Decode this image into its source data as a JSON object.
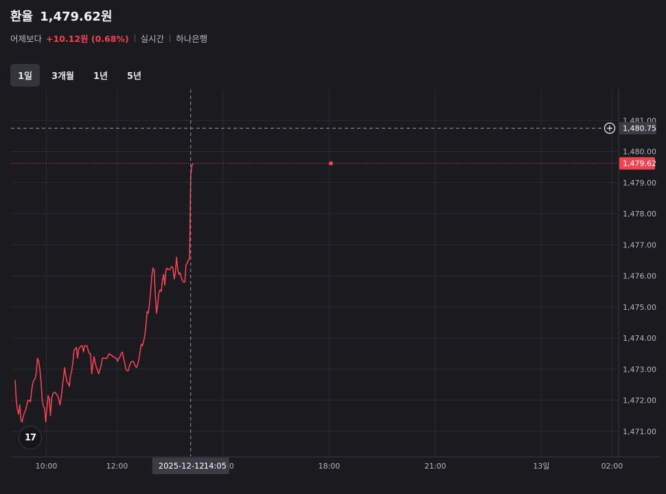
{
  "header": {
    "title": "환율",
    "price": "1,479.62원",
    "change_label": "어제보다",
    "change_value": "+10.12원 (0.68%)",
    "realtime": "실시간",
    "source": "하나은행"
  },
  "tabs": [
    {
      "label": "1일",
      "active": true
    },
    {
      "label": "3개월",
      "active": false
    },
    {
      "label": "1년",
      "active": false
    },
    {
      "label": "5년",
      "active": false
    }
  ],
  "logo_text": "17",
  "crosshair": {
    "date_label": "2025-12-12",
    "time_label": "14:05",
    "y_label": "1,480.75",
    "x_minutes": 845,
    "y_value": 1480.75
  },
  "colors": {
    "background": "#1b1a1f",
    "line": "#f04452",
    "grid": "#2a2a30",
    "axis_text": "#b5b5bc",
    "label_bg": "#3b3b43",
    "current_bg": "#f04452"
  },
  "chart_data": {
    "type": "line",
    "title": "",
    "xlabel": "",
    "ylabel": "",
    "ylim": [
      1470.2,
      1482.0
    ],
    "y_ticks": [
      1471.0,
      1472.0,
      1473.0,
      1474.0,
      1475.0,
      1476.0,
      1477.0,
      1478.0,
      1479.0,
      1480.0,
      1481.0
    ],
    "x_ticks": [
      {
        "label": "10:00",
        "minutes": 600
      },
      {
        "label": "12:00",
        "minutes": 720
      },
      {
        "label": "15:00",
        "minutes": 900
      },
      {
        "label": "18:00",
        "minutes": 1080
      },
      {
        "label": "21:00",
        "minutes": 1260
      },
      {
        "label": "13일",
        "minutes": 1440
      },
      {
        "label": "02:00",
        "minutes": 1560
      }
    ],
    "x_range_minutes": [
      540,
      1570
    ],
    "last_value_label": "1,479.62",
    "series": [
      {
        "x_minutes": [
          547,
          549,
          551,
          553,
          555,
          557,
          559,
          561,
          563,
          565,
          567,
          569,
          571,
          573,
          575,
          577,
          579,
          581,
          583,
          585,
          587,
          589,
          591,
          593,
          595,
          597,
          599,
          601,
          603,
          605,
          607,
          609,
          611,
          613,
          615,
          617,
          619,
          621,
          623,
          625,
          627,
          629,
          631,
          633,
          635,
          637,
          639,
          641,
          643,
          645,
          647,
          649,
          651,
          653,
          655,
          657,
          659,
          661,
          663,
          665,
          667,
          669,
          671,
          673,
          675,
          677,
          679,
          681,
          683,
          685,
          687,
          689,
          691,
          693,
          695,
          697,
          699,
          701,
          703,
          705,
          707,
          709,
          711,
          713,
          715,
          717,
          719,
          721,
          723,
          725,
          727,
          729,
          731,
          733,
          735,
          737,
          739,
          741,
          743,
          745,
          747,
          749,
          751,
          753,
          755,
          757,
          759,
          761,
          763,
          765,
          767,
          769,
          771,
          773,
          775,
          777,
          779,
          781,
          783,
          785,
          787,
          789,
          791,
          793,
          795,
          797,
          799,
          801,
          803,
          805,
          807,
          809,
          811,
          813,
          815,
          817,
          819,
          821,
          823,
          825,
          827,
          829,
          831,
          833,
          835,
          837,
          839,
          841,
          843,
          845,
          847,
          849,
          851,
          853,
          855,
          857,
          859,
          861,
          863,
          865,
          867,
          869,
          871,
          873,
          875,
          877,
          879,
          881,
          883,
          885,
          887,
          889,
          891,
          893,
          895,
          897,
          899,
          901,
          903,
          905,
          907,
          909,
          911,
          913,
          915,
          917,
          919,
          921,
          923,
          925,
          927,
          929,
          931,
          933,
          935,
          937,
          939,
          941,
          943,
          945,
          947,
          949,
          951,
          953,
          955,
          957,
          959,
          961,
          963,
          965,
          967,
          969,
          971,
          973,
          975,
          977,
          979,
          981,
          983,
          985,
          987,
          989,
          991,
          993,
          995,
          997,
          999,
          1001,
          1003,
          1005,
          1007,
          1009,
          1011,
          1013,
          1015,
          1017,
          1019,
          1021,
          1023,
          1025,
          1027,
          1029,
          1031,
          1033,
          1035,
          1037,
          1039,
          1041,
          1043,
          1045,
          1047,
          1049,
          1051,
          1053,
          1055,
          1057,
          1059,
          1061,
          1063,
          1065,
          1067,
          1069,
          1071,
          1073,
          1075,
          1077,
          1079,
          1081,
          1083
        ],
        "values": [
          1472.65,
          1472.0,
          1471.7,
          1471.55,
          1471.85,
          1471.35,
          1471.3,
          1471.5,
          1471.6,
          1471.7,
          1471.85,
          1472.0,
          1472.0,
          1471.95,
          1472.3,
          1472.55,
          1472.65,
          1472.7,
          1472.9,
          1473.35,
          1473.25,
          1473.0,
          1472.6,
          1472.0,
          1471.8,
          1471.75,
          1471.3,
          1471.75,
          1472.15,
          1472.05,
          1471.5,
          1472.05,
          1472.2,
          1472.25,
          1472.25,
          1472.2,
          1472.15,
          1472.05,
          1471.85,
          1472.05,
          1472.4,
          1472.7,
          1473.05,
          1472.8,
          1472.6,
          1472.55,
          1472.45,
          1472.8,
          1472.95,
          1473.2,
          1473.6,
          1473.65,
          1473.7,
          1473.35,
          1473.65,
          1473.7,
          1473.75,
          1473.75,
          1473.55,
          1473.75,
          1473.75,
          1473.75,
          1473.6,
          1473.5,
          1473.5,
          1472.85,
          1473.15,
          1473.4,
          1473.2,
          1473.05,
          1472.95,
          1472.85,
          1473.0,
          1473.1,
          1473.35,
          1473.35,
          1473.35,
          1473.35,
          1473.35,
          1473.45,
          1473.5,
          1473.45,
          1473.45,
          1473.4,
          1473.4,
          1473.35,
          1473.35,
          1473.25,
          1473.35,
          1473.4,
          1473.5,
          1473.55,
          1473.35,
          1473.2,
          1473.0,
          1472.95,
          1472.95,
          1473.1,
          1473.2,
          1473.25,
          1473.25,
          1473.2,
          1473.1,
          1473.05,
          1473.15,
          1473.3,
          1473.55,
          1473.8,
          1473.75,
          1473.9,
          1474.05,
          1474.4,
          1474.85,
          1474.8,
          1475.1,
          1475.5,
          1476.0,
          1476.25,
          1476.2,
          1475.35,
          1474.8,
          1475.1,
          1475.45,
          1475.55,
          1475.5,
          1475.85,
          1476.05,
          1475.7,
          1476.2,
          1476.25,
          1476.2,
          1476.2,
          1476.25,
          1476.3,
          1476.25,
          1475.9,
          1476.1,
          1476.6,
          1476.2,
          1476.05,
          1476.1,
          1475.95,
          1475.85,
          1475.8,
          1475.8,
          1476.35,
          1476.4,
          1476.5,
          1476.55,
          1479.2,
          1479.55,
          1479.62
        ]
      }
    ]
  }
}
